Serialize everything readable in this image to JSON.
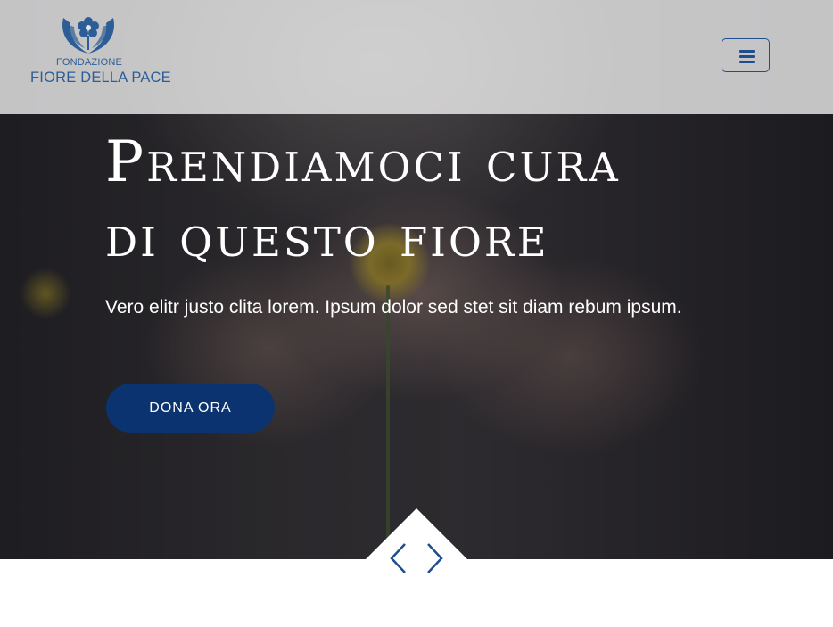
{
  "brand": {
    "logo_small": "FONDAZIONE",
    "logo_name": "FIORE DELLA PACE",
    "color": "#2d5d96"
  },
  "navbar": {
    "menu_icon": "hamburger-menu-icon"
  },
  "hero": {
    "title_line1": "Prendiamoci cura",
    "title_line2": "di questo fiore",
    "subtitle": "Vero elitr justo clita lorem. Ipsum dolor sed stet sit diam rebum ipsum.",
    "cta_label": "DONA ORA",
    "cta_color": "#0b3370"
  },
  "carousel": {
    "prev_icon": "chevron-left-icon",
    "next_icon": "chevron-right-icon",
    "arrow_color": "#1e4f8c"
  }
}
